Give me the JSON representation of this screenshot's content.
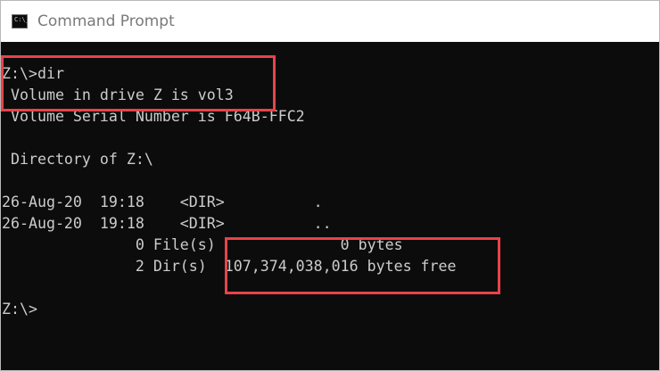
{
  "window": {
    "title": "Command Prompt",
    "icon": "cmd-console-icon",
    "icon_glyph": "C:\\_"
  },
  "console": {
    "lines": [
      "Z:\\>dir",
      " Volume in drive Z is vol3",
      " Volume Serial Number is F64B-FFC2",
      "",
      " Directory of Z:\\",
      "",
      "26-Aug-20  19:18    <DIR>          .",
      "26-Aug-20  19:18    <DIR>          ..",
      "               0 File(s)              0 bytes",
      "               2 Dir(s)  107,374,038,016 bytes free",
      "",
      "Z:\\>"
    ]
  },
  "colors": {
    "console_background": "#0c0c0c",
    "console_text": "#cccccc",
    "highlight": "#e8434a",
    "title_text": "#7a7a7a"
  }
}
